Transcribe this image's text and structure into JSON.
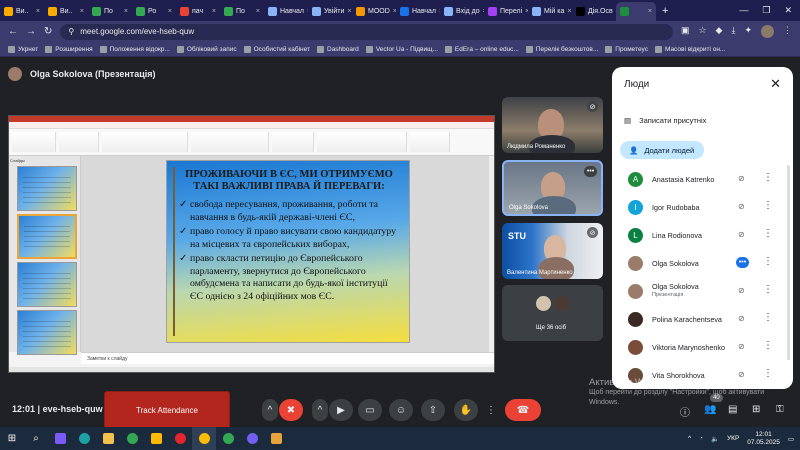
{
  "browser": {
    "tabs": [
      {
        "title": "Ви..",
        "color": "#f9ab00",
        "icon": "doc-icon"
      },
      {
        "title": "Ви..",
        "color": "#f9ab00",
        "icon": "doc-icon"
      },
      {
        "title": "По",
        "color": "#34a853",
        "icon": "globe-icon"
      },
      {
        "title": "Ро",
        "color": "#34a853",
        "icon": "globe-icon"
      },
      {
        "title": "пач",
        "color": "#ea4335",
        "icon": "mail-icon"
      },
      {
        "title": "По",
        "color": "#34a853",
        "icon": "globe-icon"
      },
      {
        "title": "Навчал",
        "color": "#8ab4f8",
        "icon": "window-icon"
      },
      {
        "title": "Увійти",
        "color": "#8ab4f8",
        "icon": "window-icon"
      },
      {
        "title": "MOOD",
        "color": "#f29900",
        "icon": "moodle-icon"
      },
      {
        "title": "Навчал",
        "color": "#1a73e8",
        "icon": "cloud-icon"
      },
      {
        "title": "Вхід до",
        "color": "#8ab4f8",
        "icon": "window-icon"
      },
      {
        "title": "Перелі",
        "color": "#a142f4",
        "icon": "list-icon"
      },
      {
        "title": "Мій ка",
        "color": "#8ab4f8",
        "icon": "window-icon"
      },
      {
        "title": "Дія.Осв",
        "color": "#000000",
        "icon": "diia-icon"
      },
      {
        "title": "",
        "color": "#1e8e3e",
        "icon": "meet-icon",
        "active": true
      }
    ],
    "add_tab": "+",
    "url": "meet.google.com/eve-hseb-quw",
    "bookmarks": [
      "Укрнет",
      "Розширення",
      "Положення відокр...",
      "Обліковий запис",
      "Особистий кабінет",
      "Dashboard",
      "Vector Ua - Підвищ...",
      "EdEra – online educ...",
      "Перелік безкоштов...",
      "Прометеус",
      "Масові відкриті он..."
    ]
  },
  "meet": {
    "presenter": "Olga Sokolova (Презентація)",
    "slide": {
      "title": "ПРОЖИВАЮЧИ В ЄС, МИ ОТРИМУЄМО ТАКІ ВАЖЛИВІ ПРАВА Й ПЕРЕВАГИ:",
      "bullets": [
        "свобода пересування, проживання, роботи та навчання в будь-якій державі-члені ЄС,",
        "право голосу й право висувати свою кандидатуру на місцевих та європейських виборах,",
        "право скласти петицію до Європейського парламенту, звернутися до Європейського омбудсмена та написати до будь-якої інституції ЄС однією з 24 офіційних мов ЄС."
      ],
      "tick": "✓",
      "notes": "Заметки к слайду",
      "slides_tab": "Слайды"
    },
    "tiles": [
      {
        "name": "Людмила Романенко"
      },
      {
        "name": "Olga Sokolova"
      },
      {
        "name": "Валентина Мартиненко"
      },
      {
        "name": "Ще 36 осіб"
      }
    ],
    "panel": {
      "title": "Люди",
      "record": "Записати присутніх",
      "add": "Додати людей",
      "people": [
        {
          "name": "Anastasia Katrenko",
          "initial": "A",
          "color": "#1e8e3e"
        },
        {
          "name": "Igor Rudobaba",
          "initial": "I",
          "color": "#12a4d9"
        },
        {
          "name": "Lina Rodionova",
          "initial": "L",
          "color": "#0b8043"
        },
        {
          "name": "Olga Sokolova",
          "initial": "",
          "color": "#9b7b6a",
          "speaking": true
        },
        {
          "name": "Olga Sokolova",
          "sub": "Презентація",
          "initial": "",
          "color": "#9b7b6a"
        },
        {
          "name": "Polina Karachentseva",
          "initial": "",
          "color": "#3b2a24"
        },
        {
          "name": "Viktoria Marynoshenko",
          "initial": "",
          "color": "#7a4d3a"
        },
        {
          "name": "Vita Shorokhova",
          "initial": "",
          "color": "#6b4c3b"
        }
      ]
    },
    "watermark": {
      "title": "Активація Windows",
      "text": "Щоб перейти до розділу \"Настройки\", щоб активувати Windows."
    },
    "meeting_time": "12:01",
    "meeting_code": "eve-hseb-quw",
    "track_attendance": "Track Attendance",
    "participants_badge": "40"
  },
  "taskbar": {
    "lang": "УКР",
    "time": "12:01",
    "date": "07.05.2025"
  }
}
